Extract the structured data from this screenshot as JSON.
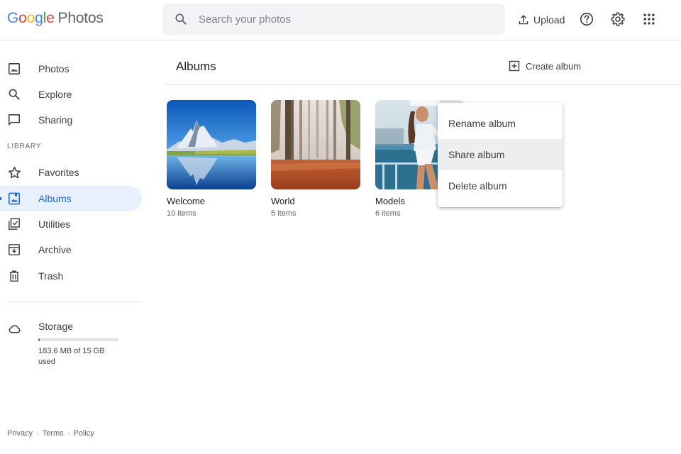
{
  "header": {
    "logo": {
      "letters": [
        "G",
        "o",
        "o",
        "g",
        "l",
        "e"
      ],
      "letter_colors": [
        "#4285f4",
        "#ea4335",
        "#fbbc05",
        "#4285f4",
        "#34a853",
        "#ea4335"
      ],
      "product": "Photos"
    },
    "search": {
      "placeholder": "Search your photos",
      "value": "",
      "icon": "search-icon"
    },
    "upload_label": "Upload",
    "icons": [
      "help-icon",
      "settings-icon",
      "apps-grid-icon"
    ]
  },
  "sidebar": {
    "items": [
      {
        "label": "Photos",
        "icon": "photo-icon"
      },
      {
        "label": "Explore",
        "icon": "search-icon"
      },
      {
        "label": "Sharing",
        "icon": "chat-bubble-icon"
      }
    ],
    "library_label": "LIBRARY",
    "library_items": [
      {
        "label": "Favorites",
        "icon": "star-icon"
      },
      {
        "label": "Albums",
        "icon": "album-icon",
        "active": true
      },
      {
        "label": "Utilities",
        "icon": "utilities-icon"
      },
      {
        "label": "Archive",
        "icon": "archive-icon"
      },
      {
        "label": "Trash",
        "icon": "trash-icon"
      }
    ],
    "storage": {
      "title": "Storage",
      "icon": "cloud-icon",
      "used_text": "183.6 MB of 15 GB used",
      "used_fraction": 0.012
    },
    "footer": {
      "privacy": "Privacy",
      "terms": "Terms",
      "policy": "Policy",
      "separator": "·"
    }
  },
  "main": {
    "title": "Albums",
    "create_album_label": "Create album",
    "albums": [
      {
        "title": "Welcome",
        "count": "10 items"
      },
      {
        "title": "World",
        "count": "5 items"
      },
      {
        "title": "Models",
        "count": "6 items"
      }
    ]
  },
  "context_menu": {
    "items": [
      {
        "label": "Rename album"
      },
      {
        "label": "Share album",
        "highlighted": true
      },
      {
        "label": "Delete album"
      }
    ]
  },
  "colors": {
    "accent": "#1967d2",
    "active_bg": "#e8f0fe",
    "search_bg": "#f1f3f4",
    "storage_fill": "#1a73e8"
  }
}
